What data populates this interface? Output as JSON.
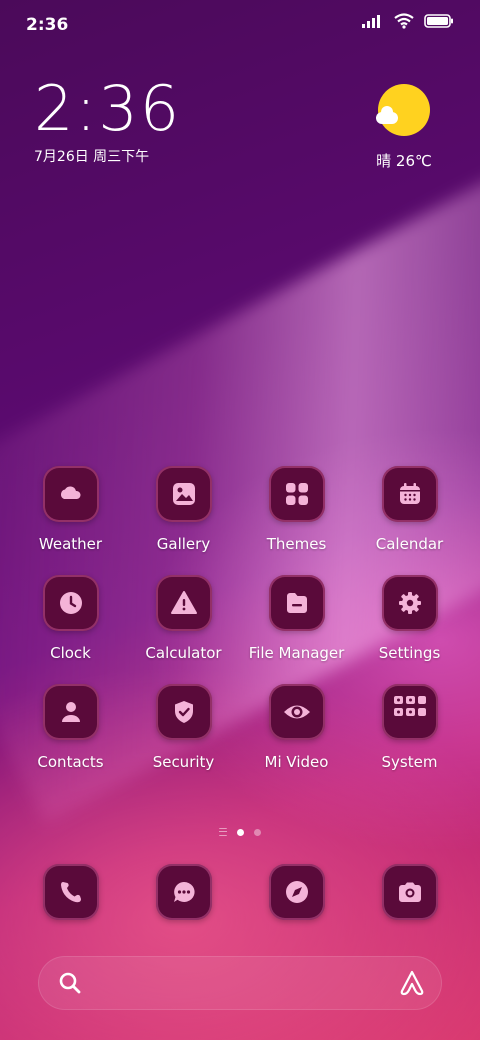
{
  "status_bar": {
    "time": "2:36",
    "icons": [
      "signal-icon",
      "wifi-icon",
      "battery-icon"
    ]
  },
  "clock_widget": {
    "time": "2:36",
    "date": "7月26日 周三下午"
  },
  "weather_widget": {
    "icon": "sunny-cloud-icon",
    "text": "晴 26℃"
  },
  "apps": [
    {
      "label": "Weather",
      "icon": "cloud-icon"
    },
    {
      "label": "Gallery",
      "icon": "image-icon"
    },
    {
      "label": "Themes",
      "icon": "grid-icon"
    },
    {
      "label": "Calendar",
      "icon": "calendar-icon"
    },
    {
      "label": "Clock",
      "icon": "clock-icon"
    },
    {
      "label": "Calculator",
      "icon": "warning-icon"
    },
    {
      "label": "File Manager",
      "icon": "folder-icon"
    },
    {
      "label": "Settings",
      "icon": "gear-icon"
    },
    {
      "label": "Contacts",
      "icon": "person-icon"
    },
    {
      "label": "Security",
      "icon": "shield-check-icon"
    },
    {
      "label": "Mi Video",
      "icon": "eye-icon"
    },
    {
      "label": "System",
      "icon": "folder-grid-icon"
    }
  ],
  "dock": [
    {
      "icon": "phone-icon"
    },
    {
      "icon": "message-icon"
    },
    {
      "icon": "compass-icon"
    },
    {
      "icon": "camera-icon"
    }
  ],
  "page_indicator": {
    "pages": 2,
    "active": 1
  },
  "search_bar": {
    "left_icon": "search-icon",
    "right_icon": "assistant-icon"
  },
  "colors": {
    "icon_bg": "#5a0a3a",
    "glyph": "#f4b3d8",
    "sun": "#ffd21f"
  }
}
